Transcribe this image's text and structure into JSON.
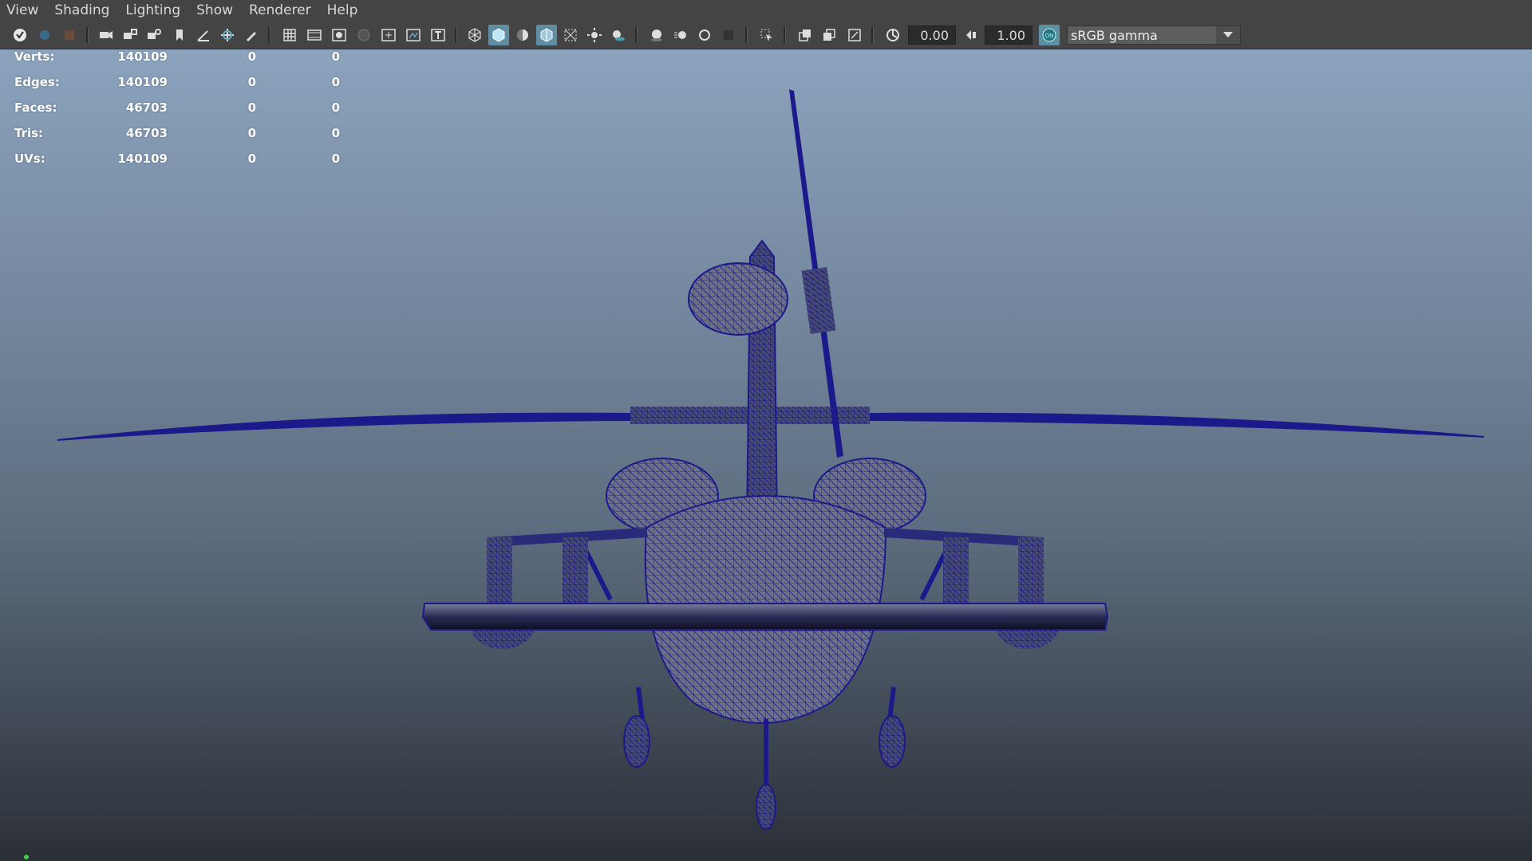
{
  "menubar": {
    "items": [
      "View",
      "Shading",
      "Lighting",
      "Show",
      "Renderer",
      "Help"
    ]
  },
  "toolbar": {
    "exposure_value": "0.00",
    "gamma_value": "1.00",
    "color_space": "sRGB gamma",
    "icons": [
      "select-camera-icon",
      "lock-camera-icon",
      "camera-attributes-icon",
      "image-plane-icon",
      "bookmark-icon",
      "grease-pencil-icon",
      "2d-pan-zoom-icon",
      "grid-icon",
      "film-gate-icon",
      "resolution-gate-icon",
      "gate-mask-icon",
      "field-chart-icon",
      "safe-action-icon",
      "safe-title-icon",
      "wireframe-icon",
      "smooth-shade-icon",
      "wireframe-on-shaded-icon",
      "xray-icon",
      "textured-icon",
      "lighting-icon",
      "shadows-icon",
      "screen-space-ao-icon",
      "motion-blur-icon",
      "multisample-aa-icon",
      "depth-of-field-icon",
      "isolate-select-icon",
      "xray-joints-icon",
      "xray-active-icon",
      "backface-culling-icon",
      "exposure-icon",
      "gamma-icon",
      "color-management-icon"
    ],
    "active_color": "#5f8da1"
  },
  "hud": {
    "rows": [
      {
        "label": "Verts:",
        "v1": "140109",
        "v2": "0",
        "v3": "0"
      },
      {
        "label": "Edges:",
        "v1": "140109",
        "v2": "0",
        "v3": "0"
      },
      {
        "label": "Faces:",
        "v1": "46703",
        "v2": "0",
        "v3": "0"
      },
      {
        "label": "Tris:",
        "v1": "46703",
        "v2": "0",
        "v3": "0"
      },
      {
        "label": "UVs:",
        "v1": "140109",
        "v2": "0",
        "v3": "0"
      }
    ]
  },
  "viewport": {
    "wire_color": "#1c1a8a",
    "surface_color": "#6d7187"
  }
}
